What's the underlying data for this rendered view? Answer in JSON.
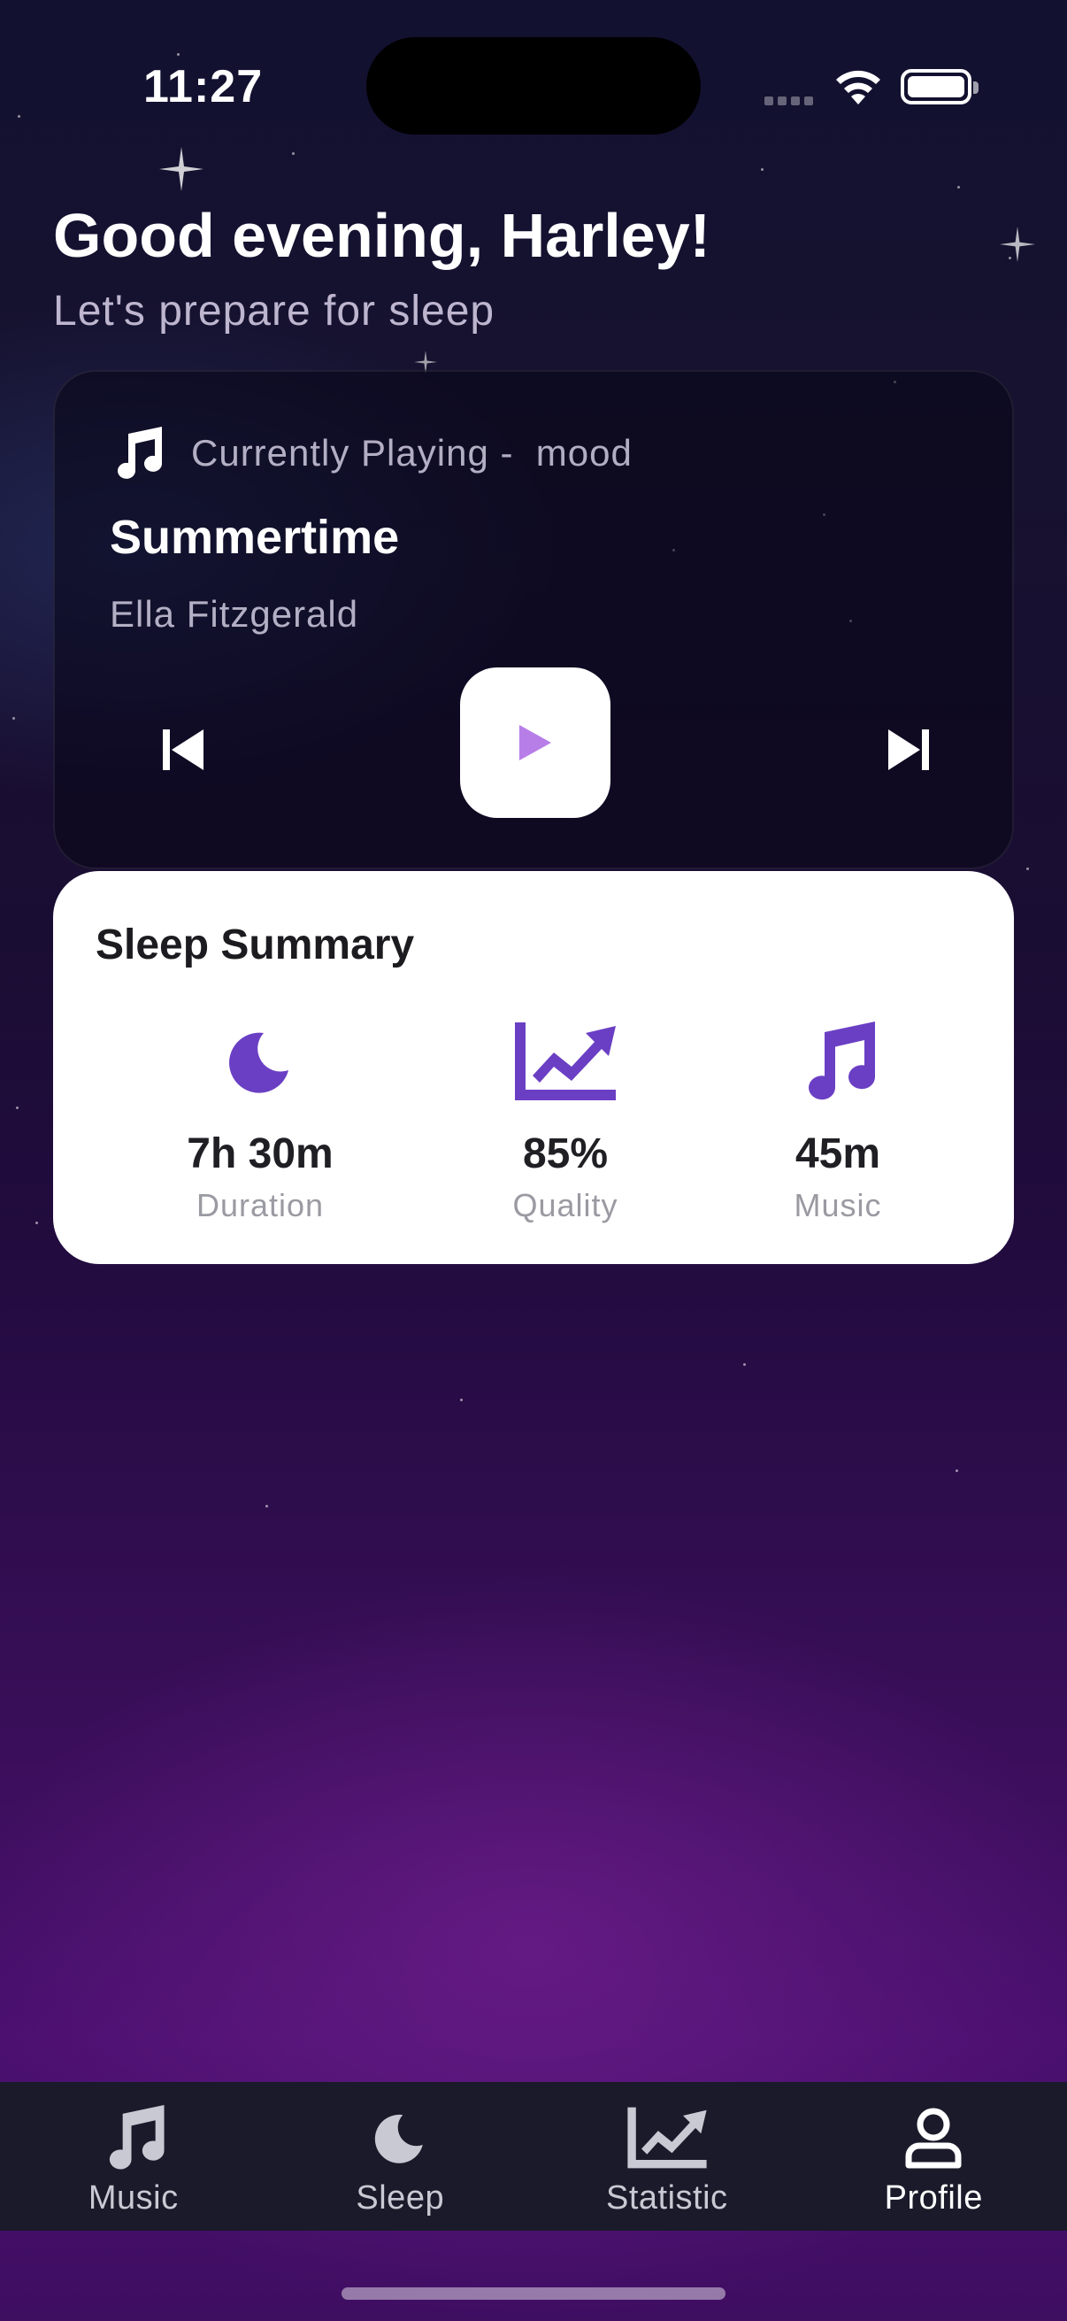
{
  "status_bar": {
    "time": "11:27"
  },
  "header": {
    "greeting": "Good evening, Harley!",
    "subtitle": "Let's prepare for sleep"
  },
  "player": {
    "label": "Currently Playing -  mood",
    "title": "Summertime",
    "artist": "Ella Fitzgerald",
    "icons": {
      "note": "music-note-icon",
      "prev": "skip-previous-icon",
      "play": "play-icon",
      "next": "skip-next-icon"
    },
    "play_icon_color": "#b77ee8"
  },
  "summary": {
    "title": "Sleep Summary",
    "accent_color": "#6a3fc4",
    "stats": [
      {
        "value": "7h 30m",
        "caption": "Duration",
        "icon": "moon-icon"
      },
      {
        "value": "85%",
        "caption": "Quality",
        "icon": "trending-chart-icon"
      },
      {
        "value": "45m",
        "caption": "Music",
        "icon": "music-note-icon"
      }
    ]
  },
  "tabs": [
    {
      "label": "Music",
      "icon": "music-note-icon",
      "active": false
    },
    {
      "label": "Sleep",
      "icon": "moon-icon",
      "active": false
    },
    {
      "label": "Statistic",
      "icon": "trending-chart-icon",
      "active": false
    },
    {
      "label": "Profile",
      "icon": "person-icon",
      "active": true
    }
  ]
}
